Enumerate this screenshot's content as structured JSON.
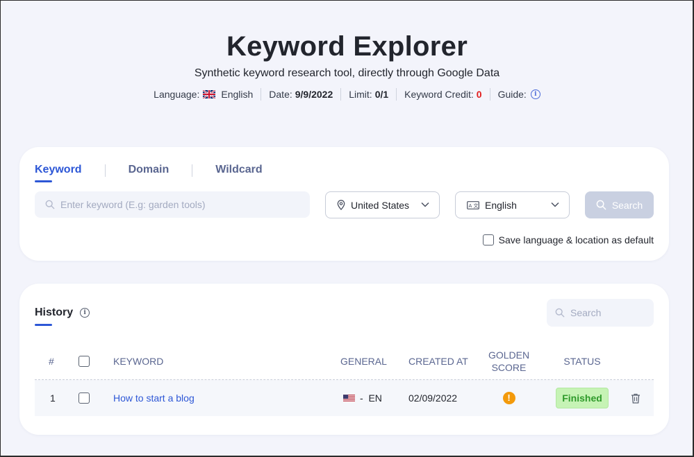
{
  "header": {
    "title": "Keyword Explorer",
    "subtitle": "Synthetic keyword research tool, directly through Google Data",
    "language_label": "Language:",
    "language_value": "English",
    "date_label": "Date:",
    "date_value": "9/9/2022",
    "limit_label": "Limit:",
    "limit_value": "0/1",
    "credit_label": "Keyword Credit:",
    "credit_value": "0",
    "guide_label": "Guide:"
  },
  "search": {
    "tabs": [
      {
        "label": "Keyword",
        "active": true
      },
      {
        "label": "Domain",
        "active": false
      },
      {
        "label": "Wildcard",
        "active": false
      }
    ],
    "keyword_placeholder": "Enter keyword (E.g: garden tools)",
    "location": "United States",
    "language": "English",
    "search_label": "Search",
    "save_default_label": "Save language & location as default"
  },
  "history": {
    "title": "History",
    "search_placeholder": "Search",
    "columns": {
      "num": "#",
      "keyword": "KEYWORD",
      "general": "GENERAL",
      "created_at": "CREATED AT",
      "golden_score": "GOLDEN SCORE",
      "status": "STATUS"
    },
    "rows": [
      {
        "num": "1",
        "keyword": "How to start a blog",
        "general": "-  EN",
        "created_at": "02/09/2022",
        "golden_score_icon": "warning-icon",
        "status": "Finished"
      }
    ]
  },
  "colors": {
    "accent": "#2d57d6",
    "credit_red": "#e11d1d",
    "status_green": "#2e9a2a",
    "warning_orange": "#f39a0b"
  }
}
